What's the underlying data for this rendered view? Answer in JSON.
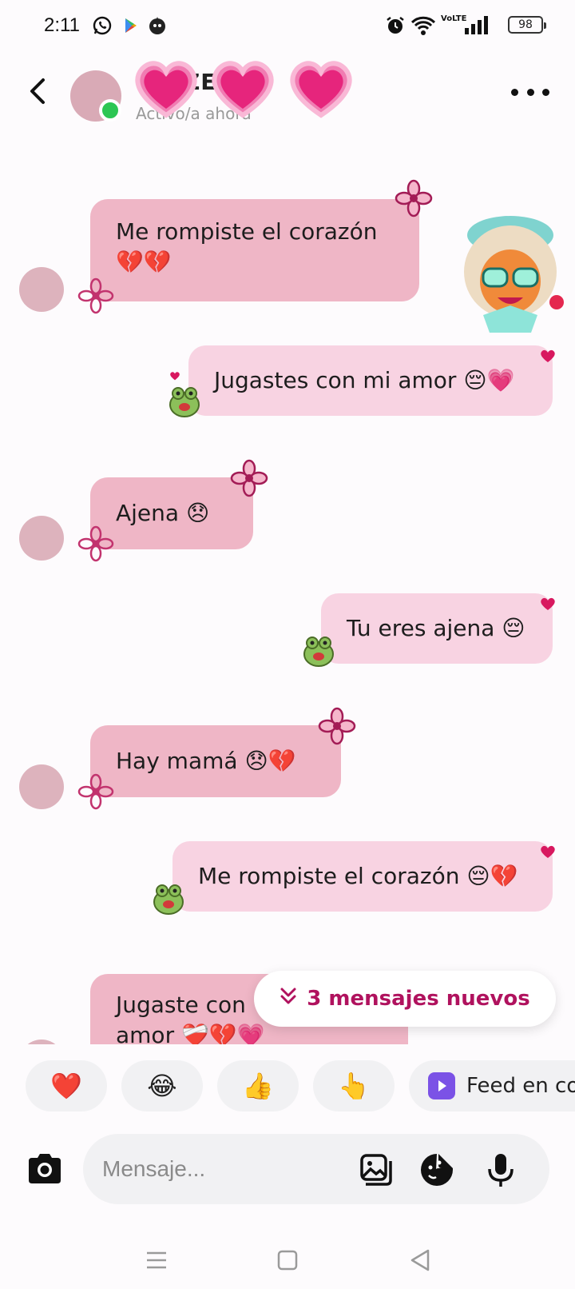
{
  "status_bar": {
    "time": "2:11",
    "battery": "98",
    "network": "VoLTE"
  },
  "header": {
    "contact_name": "ZE",
    "status": "Activo/a ahora"
  },
  "messages": [
    {
      "direction": "received",
      "text": "Me rompiste el corazón\n💔💔"
    },
    {
      "direction": "sent",
      "text": "Jugastes con mi amor 😔💗"
    },
    {
      "direction": "received",
      "text": "Ajena 😞"
    },
    {
      "direction": "sent",
      "text": "Tu eres ajena 😔"
    },
    {
      "direction": "received",
      "text": "Hay mamá 😞💔"
    },
    {
      "direction": "sent",
      "text": "Me rompiste el corazón 😔💔"
    },
    {
      "direction": "received",
      "text": "Jugaste con\namor ❤️‍🩹💔💗"
    }
  ],
  "new_messages_pill": "3 mensajes nuevos",
  "quick_reactions": [
    "❤️",
    "😂",
    "👍",
    "👆"
  ],
  "feed_button": "Feed en co",
  "composer": {
    "placeholder": "Mensaje..."
  },
  "colors": {
    "received_bubble": "#efb6c6",
    "sent_bubble": "#f8d3e2",
    "accent": "#b0125e",
    "online": "#2cc653"
  }
}
